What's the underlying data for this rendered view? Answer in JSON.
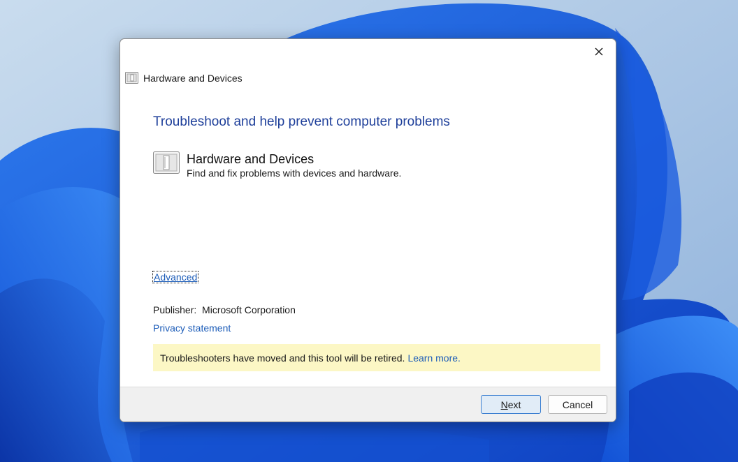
{
  "window": {
    "title": "Hardware and Devices",
    "close_icon": "close-icon",
    "title_icon": "hardware-devices-icon"
  },
  "main": {
    "heading": "Troubleshoot and help prevent computer problems",
    "troubleshooter": {
      "icon": "hardware-devices-icon",
      "title": "Hardware and Devices",
      "description": "Find and fix problems with devices and hardware."
    },
    "advanced_link": "Advanced",
    "publisher_label": "Publisher:",
    "publisher_value": "Microsoft Corporation",
    "privacy_link": "Privacy statement",
    "notice": {
      "text": "Troubleshooters have moved and this tool will be retired.",
      "link": "Learn more."
    }
  },
  "footer": {
    "next_label": "Next",
    "cancel_label": "Cancel"
  },
  "colors": {
    "heading": "#1e3f9a",
    "link": "#1c5cb8",
    "notice_background": "#fcf7c5",
    "primary_button_border": "#3b7fd1",
    "footer_background": "#f0f0f0"
  }
}
